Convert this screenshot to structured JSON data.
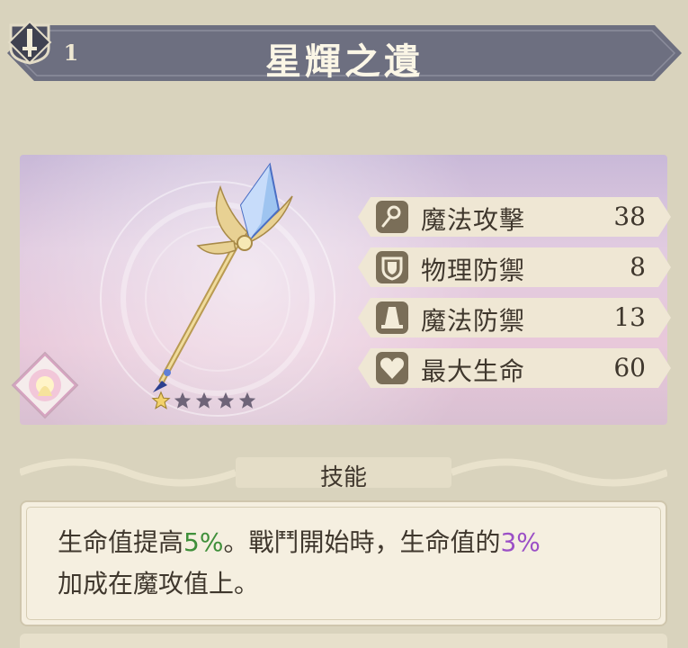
{
  "header": {
    "rank": "1",
    "item_name": "星輝之遺",
    "rank_icon": "shield-badge-icon",
    "equip_icon": "sword-diamond-icon"
  },
  "weapon": {
    "rarity": 1,
    "max_rarity": 5,
    "element_icon": "light-element-icon"
  },
  "stats": [
    {
      "icon": "wand-icon",
      "label": "魔法攻擊",
      "value": "38"
    },
    {
      "icon": "shield-icon",
      "label": "物理防禦",
      "value": "8"
    },
    {
      "icon": "wizard-hat-icon",
      "label": "魔法防禦",
      "value": "13"
    },
    {
      "icon": "heart-icon",
      "label": "最大生命",
      "value": "60"
    }
  ],
  "skill": {
    "title": "技能",
    "desc_part1": "生命值提高",
    "desc_value1": "5%",
    "desc_part2": "。戰鬥開始時，生命值的",
    "desc_value2": "3%",
    "desc_part3": "加成在魔攻值上。"
  },
  "colors": {
    "banner": "#6d6f80",
    "panel_text": "#3f372d",
    "highlight_green": "#3f8f3a",
    "highlight_purple": "#9b4fc6",
    "background": "#d9d3bd"
  }
}
